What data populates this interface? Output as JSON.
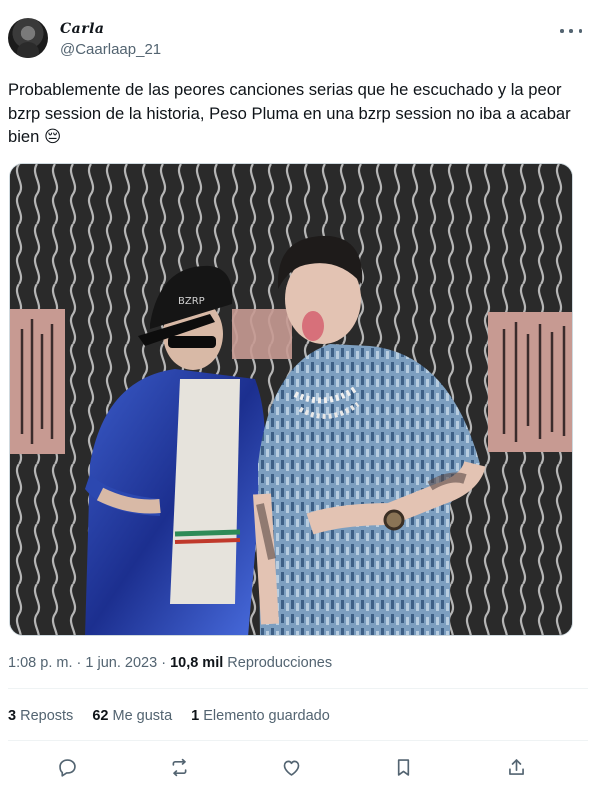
{
  "author": {
    "display_name": "Carla",
    "handle": "@Caarlaap_21"
  },
  "tweet": {
    "text": "Probablemente de las peores canciones serias que he escuchado y la peor bzrp session de la historia, Peso Pluma en una bzrp session no iba a acabar bien 😔"
  },
  "meta": {
    "time": "1:08 p. m.",
    "separator": "·",
    "date": "1 jun. 2023",
    "views_count": "10,8 mil",
    "views_label": "Reproducciones"
  },
  "stats": {
    "reposts_count": "3",
    "reposts_label": "Reposts",
    "likes_count": "62",
    "likes_label": "Me gusta",
    "bookmarks_count": "1",
    "bookmarks_label": "Elemento guardado"
  },
  "media": {
    "cap_text": "BZRP"
  },
  "icons": {
    "more": "more-horizontal-icon",
    "reply": "reply-icon",
    "repost": "repost-icon",
    "like": "heart-icon",
    "bookmark": "bookmark-icon",
    "share": "share-icon"
  },
  "colors": {
    "text_primary": "#0f1419",
    "text_secondary": "#536471",
    "divider": "#eff3f4"
  }
}
